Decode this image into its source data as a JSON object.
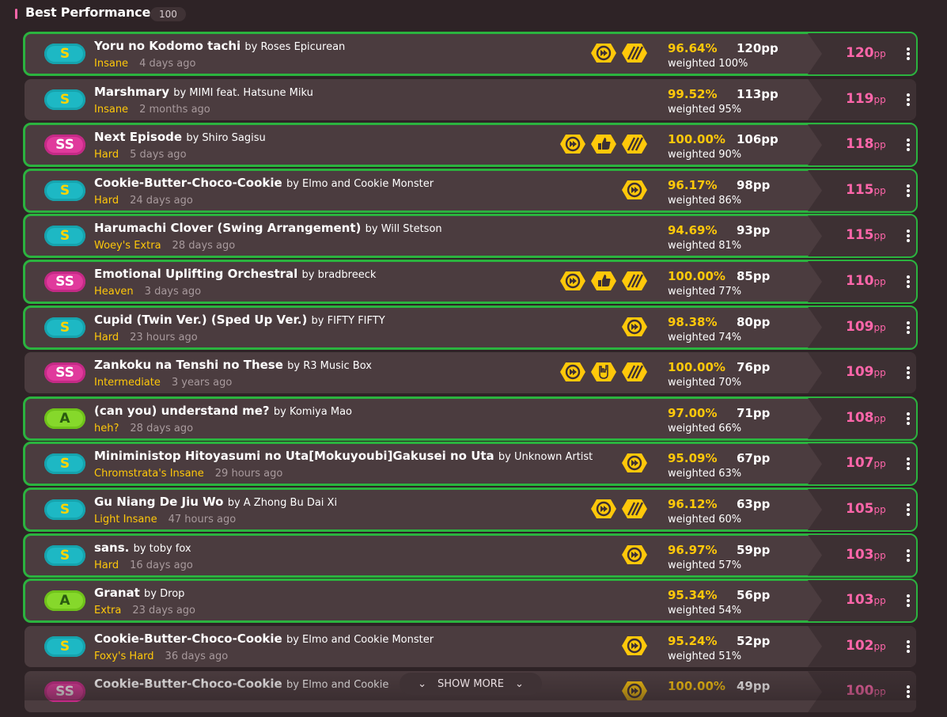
{
  "header": {
    "title": "Best Performance",
    "count": "100"
  },
  "scores": [
    {
      "grade": "S",
      "title": "Yoru no Kodomo tachi",
      "artist": "by Roses Epicurean",
      "difficulty": "Insane",
      "ago": "4 days ago",
      "mods": [
        "auto-icon",
        "dash-icon"
      ],
      "acc": "96.64%",
      "pp": "120pp",
      "weighted": "weighted 100%",
      "wpp": "120",
      "highlight": true
    },
    {
      "grade": "S",
      "title": "Marshmary",
      "artist": "by MIMI feat. Hatsune Miku",
      "difficulty": "Insane",
      "ago": "2 months ago",
      "mods": [],
      "acc": "99.52%",
      "pp": "113pp",
      "weighted": "weighted 95%",
      "wpp": "119",
      "highlight": false
    },
    {
      "grade": "SS",
      "title": "Next Episode",
      "artist": "by Shiro Sagisu",
      "difficulty": "Hard",
      "ago": "5 days ago",
      "mods": [
        "auto-icon",
        "thumb-icon",
        "dash-icon"
      ],
      "acc": "100.00%",
      "pp": "106pp",
      "weighted": "weighted 90%",
      "wpp": "118",
      "highlight": true
    },
    {
      "grade": "S",
      "title": "Cookie-Butter-Choco-Cookie",
      "artist": "by Elmo and Cookie Monster",
      "difficulty": "Hard",
      "ago": "24 days ago",
      "mods": [
        "auto-icon"
      ],
      "acc": "96.17%",
      "pp": "98pp",
      "weighted": "weighted 86%",
      "wpp": "115",
      "highlight": true
    },
    {
      "grade": "S",
      "title": "Harumachi Clover (Swing Arrangement)",
      "artist": "by Will Stetson",
      "difficulty": "Woey's Extra",
      "ago": "28 days ago",
      "mods": [],
      "acc": "94.69%",
      "pp": "93pp",
      "weighted": "weighted 81%",
      "wpp": "115",
      "highlight": true
    },
    {
      "grade": "SS",
      "title": "Emotional Uplifting Orchestral",
      "artist": "by bradbreeck",
      "difficulty": "Heaven",
      "ago": "3 days ago",
      "mods": [
        "auto-icon",
        "thumb-icon",
        "dash-icon"
      ],
      "acc": "100.00%",
      "pp": "85pp",
      "weighted": "weighted 77%",
      "wpp": "110",
      "highlight": true
    },
    {
      "grade": "S",
      "title": "Cupid (Twin Ver.) (Sped Up Ver.)",
      "artist": "by FIFTY FIFTY",
      "difficulty": "Hard",
      "ago": "23 hours ago",
      "mods": [
        "auto-icon"
      ],
      "acc": "98.38%",
      "pp": "80pp",
      "weighted": "weighted 74%",
      "wpp": "109",
      "highlight": true
    },
    {
      "grade": "SS",
      "title": "Zankoku na Tenshi no These",
      "artist": "by R3 Music Box",
      "difficulty": "Intermediate",
      "ago": "3 years ago",
      "mods": [
        "auto-icon",
        "rock-icon",
        "dash-icon"
      ],
      "acc": "100.00%",
      "pp": "76pp",
      "weighted": "weighted 70%",
      "wpp": "109",
      "highlight": false
    },
    {
      "grade": "A",
      "title": "(can you) understand me?",
      "artist": "by Komiya Mao",
      "difficulty": "heh?",
      "ago": "28 days ago",
      "mods": [],
      "acc": "97.00%",
      "pp": "71pp",
      "weighted": "weighted 66%",
      "wpp": "108",
      "highlight": true
    },
    {
      "grade": "S",
      "title": "Miniministop Hitoyasumi no Uta[Mokuyoubi]Gakusei no Uta",
      "artist": "by Unknown Artist",
      "difficulty": "Chromstrata's Insane",
      "ago": "29 hours ago",
      "mods": [
        "auto-icon"
      ],
      "acc": "95.09%",
      "pp": "67pp",
      "weighted": "weighted 63%",
      "wpp": "107",
      "highlight": true
    },
    {
      "grade": "S",
      "title": "Gu Niang De Jiu Wo",
      "artist": "by A Zhong Bu Dai Xi",
      "difficulty": "Light Insane",
      "ago": "47 hours ago",
      "mods": [
        "auto-icon",
        "dash-icon"
      ],
      "acc": "96.12%",
      "pp": "63pp",
      "weighted": "weighted 60%",
      "wpp": "105",
      "highlight": true
    },
    {
      "grade": "S",
      "title": "sans.",
      "artist": "by toby fox",
      "difficulty": "Hard",
      "ago": "16 days ago",
      "mods": [
        "auto-icon"
      ],
      "acc": "96.97%",
      "pp": "59pp",
      "weighted": "weighted 57%",
      "wpp": "103",
      "highlight": true
    },
    {
      "grade": "A",
      "title": "Granat",
      "artist": "by Drop",
      "difficulty": "Extra",
      "ago": "23 days ago",
      "mods": [],
      "acc": "95.34%",
      "pp": "56pp",
      "weighted": "weighted 54%",
      "wpp": "103",
      "highlight": true
    },
    {
      "grade": "S",
      "title": "Cookie-Butter-Choco-Cookie",
      "artist": "by Elmo and Cookie Monster",
      "difficulty": "Foxy's Hard",
      "ago": "36 days ago",
      "mods": [
        "auto-icon"
      ],
      "acc": "95.24%",
      "pp": "52pp",
      "weighted": "weighted 51%",
      "wpp": "102",
      "highlight": false
    },
    {
      "grade": "SS",
      "title": "Cookie-Butter-Choco-Cookie",
      "artist": "by Elmo and Cookie",
      "difficulty": "",
      "ago": "",
      "mods": [
        "auto-icon"
      ],
      "acc": "100.00%",
      "pp": "49pp",
      "weighted": "",
      "wpp": "100",
      "highlight": false
    }
  ],
  "pp_unit": "pp",
  "show_more_label": "SHOW MORE",
  "colors": {
    "accent": "#ff66aa",
    "gold": "#ffc80a",
    "highlight": "#2bb33f"
  }
}
